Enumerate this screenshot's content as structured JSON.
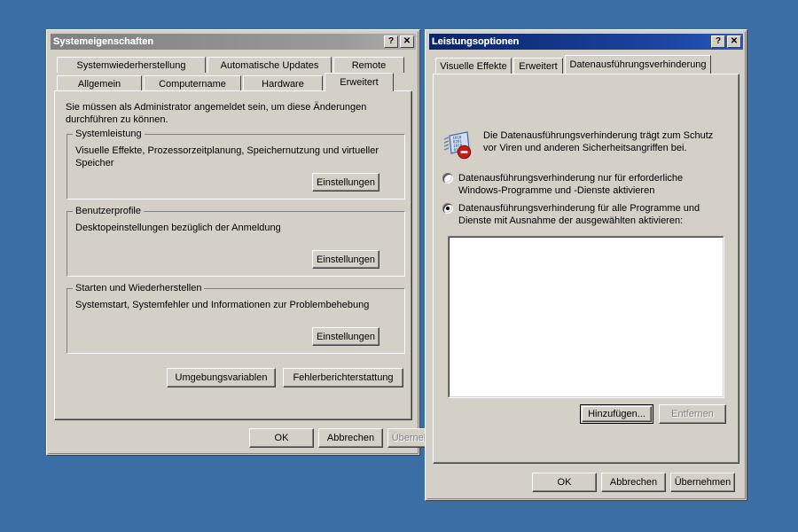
{
  "desktop": {
    "background_color": "#3b6ea5"
  },
  "windows": {
    "system_properties": {
      "title": "Systemeigenschaften",
      "active": false,
      "title_buttons": [
        {
          "name": "help-button",
          "glyph": "?"
        },
        {
          "name": "close-button",
          "glyph": "✕"
        }
      ],
      "tabs_row1": [
        {
          "label": "Systemwiederherstellung",
          "active": false
        },
        {
          "label": "Automatische Updates",
          "active": false
        },
        {
          "label": "Remote",
          "active": false
        }
      ],
      "tabs_row2": [
        {
          "label": "Allgemein",
          "active": false
        },
        {
          "label": "Computername",
          "active": false
        },
        {
          "label": "Hardware",
          "active": false
        },
        {
          "label": "Erweitert",
          "active": true
        }
      ],
      "notice": "Sie müssen als Administrator angemeldet sein, um diese Änderungen durchführen zu können.",
      "groups": [
        {
          "title": "Systemleistung",
          "description": "Visuelle Effekte, Prozessorzeitplanung, Speichernutzung und virtueller Speicher",
          "button": "Einstellungen"
        },
        {
          "title": "Benutzerprofile",
          "description": "Desktopeinstellungen bezüglich der Anmeldung",
          "button": "Einstellungen"
        },
        {
          "title": "Starten und Wiederherstellen",
          "description": "Systemstart, Systemfehler und Informationen zur Problembehebung",
          "button": "Einstellungen"
        }
      ],
      "extra_buttons": [
        {
          "label": "Umgebungsvariablen",
          "disabled": false
        },
        {
          "label": "Fehlerberichterstattung",
          "disabled": false
        }
      ],
      "footer_buttons": [
        {
          "label": "OK",
          "disabled": false
        },
        {
          "label": "Abbrechen",
          "disabled": false
        },
        {
          "label": "Übernehmen",
          "disabled": true
        }
      ]
    },
    "performance_options": {
      "title": "Leistungsoptionen",
      "active": true,
      "title_buttons": [
        {
          "name": "help-button",
          "glyph": "?"
        },
        {
          "name": "close-button",
          "glyph": "✕"
        }
      ],
      "tabs": [
        {
          "label": "Visuelle Effekte",
          "active": false
        },
        {
          "label": "Erweitert",
          "active": false
        },
        {
          "label": "Datenausführungsverhinderung",
          "active": true
        }
      ],
      "icon_name": "dep-shield-icon",
      "intro": "Die Datenausführungsverhinderung trägt zum Schutz vor Viren und anderen Sicherheitsangriffen bei.",
      "radios": [
        {
          "label": "Datenausführungsverhinderung nur für erforderliche Windows-Programme und -Dienste aktivieren",
          "checked": false
        },
        {
          "label": "Datenausführungsverhinderung für alle Programme und Dienste mit Ausnahme der ausgewählten aktivieren:",
          "checked": true
        }
      ],
      "exception_list": [],
      "list_buttons": [
        {
          "label": "Hinzufügen...",
          "disabled": false,
          "default": true
        },
        {
          "label": "Entfernen",
          "disabled": true,
          "default": false
        }
      ],
      "footer_buttons": [
        {
          "label": "OK",
          "disabled": false
        },
        {
          "label": "Abbrechen",
          "disabled": false
        },
        {
          "label": "Übernehmen",
          "disabled": false
        }
      ]
    }
  }
}
